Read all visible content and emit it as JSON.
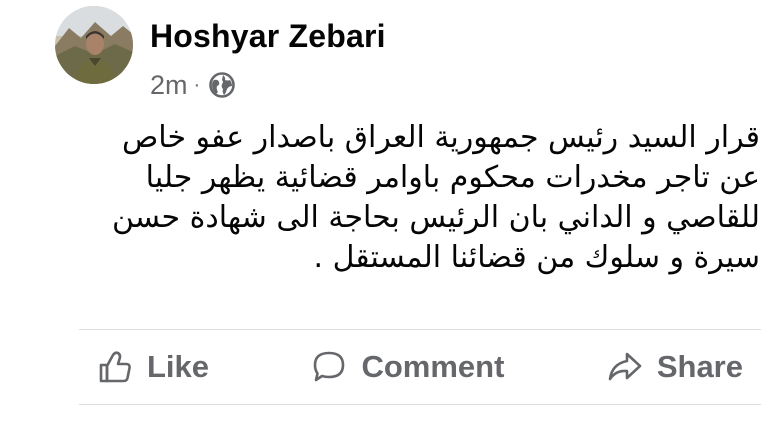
{
  "post": {
    "author": "Hoshyar Zebari",
    "timestamp": "2m",
    "separator": "·",
    "privacy_icon": "globe-icon",
    "avatar_icon": "profile-photo",
    "lines": [
      "قرار السيد رئيس جمهورية العراق باصدار عفو خاص",
      "عن تاجر مخدرات محكوم باوامر قضائية يظهر جليا",
      "للقاصي و الداني بان الرئيس بحاجة الى  شهادة حسن",
      "سيرة و سلوك من قضائنا  المستقل ."
    ]
  },
  "actions": {
    "like": {
      "label": "Like",
      "icon": "thumbs-up-icon"
    },
    "comment": {
      "label": "Comment",
      "icon": "speech-bubble-icon"
    },
    "share": {
      "label": "Share",
      "icon": "share-arrow-icon"
    }
  },
  "colors": {
    "text": "#050505",
    "secondary": "#65676b",
    "divider": "#dadde1"
  }
}
